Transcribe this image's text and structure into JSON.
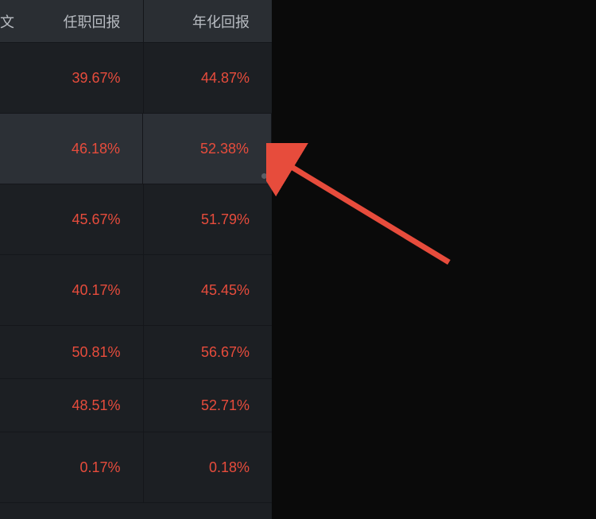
{
  "table": {
    "headers": {
      "partial_col": "文",
      "col1": "任职回报",
      "col2": "年化回报"
    },
    "rows": [
      {
        "col1": "39.67%",
        "col2": "44.87%",
        "height": "h-tall",
        "highlighted": false
      },
      {
        "col1": "46.18%",
        "col2": "52.38%",
        "height": "h-tall",
        "highlighted": true
      },
      {
        "col1": "45.67%",
        "col2": "51.79%",
        "height": "h-tall",
        "highlighted": false
      },
      {
        "col1": "40.17%",
        "col2": "45.45%",
        "height": "h-tall",
        "highlighted": false
      },
      {
        "col1": "50.81%",
        "col2": "56.67%",
        "height": "h-med",
        "highlighted": false
      },
      {
        "col1": "48.51%",
        "col2": "52.71%",
        "height": "h-med",
        "highlighted": false
      },
      {
        "col1": "0.17%",
        "col2": "0.18%",
        "height": "h-tall",
        "highlighted": false
      }
    ]
  },
  "annotation": {
    "type": "arrow",
    "color": "#e74c3c"
  }
}
